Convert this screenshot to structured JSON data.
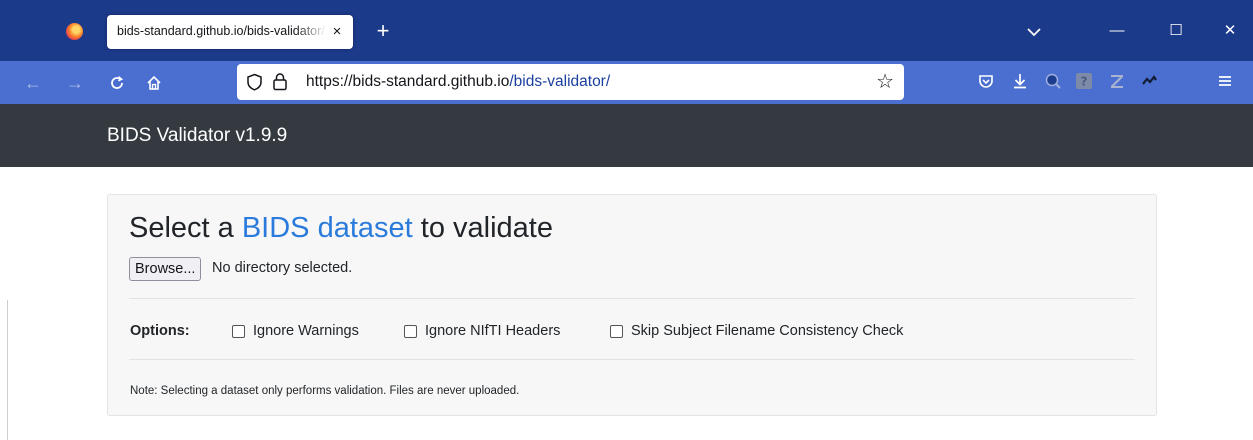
{
  "browser": {
    "tab_title": "bids-standard.github.io/bids-validator/",
    "tab_close_glyph": "×",
    "new_tab_glyph": "+",
    "url_host": "https://bids-standard.github.io",
    "url_path": "/bids-validator/",
    "window_controls": {
      "minimize": "—",
      "maximize": "☐",
      "close": "✕"
    },
    "nav": {
      "back": "←",
      "forward": "→",
      "reload": "C",
      "star": "☆"
    },
    "colors": {
      "tabbar": "#1c3a8a",
      "navbar": "#4a6fd0"
    }
  },
  "site": {
    "brand": "BIDS Validator v1.9.9",
    "heading_prefix": "Select a ",
    "heading_link": "BIDS dataset",
    "heading_suffix": " to validate",
    "browse_label": "Browse...",
    "no_directory": "No directory selected.",
    "options_label": "Options:",
    "options": [
      {
        "label": "Ignore Warnings",
        "checked": false
      },
      {
        "label": "Ignore NIfTI Headers",
        "checked": false
      },
      {
        "label": "Skip Subject Filename Consistency Check",
        "checked": false
      }
    ],
    "note": "Note: Selecting a dataset only performs validation. Files are never uploaded.",
    "colors": {
      "header": "#343a40",
      "link": "#2a7bdb",
      "card": "#f7f7f7"
    }
  }
}
